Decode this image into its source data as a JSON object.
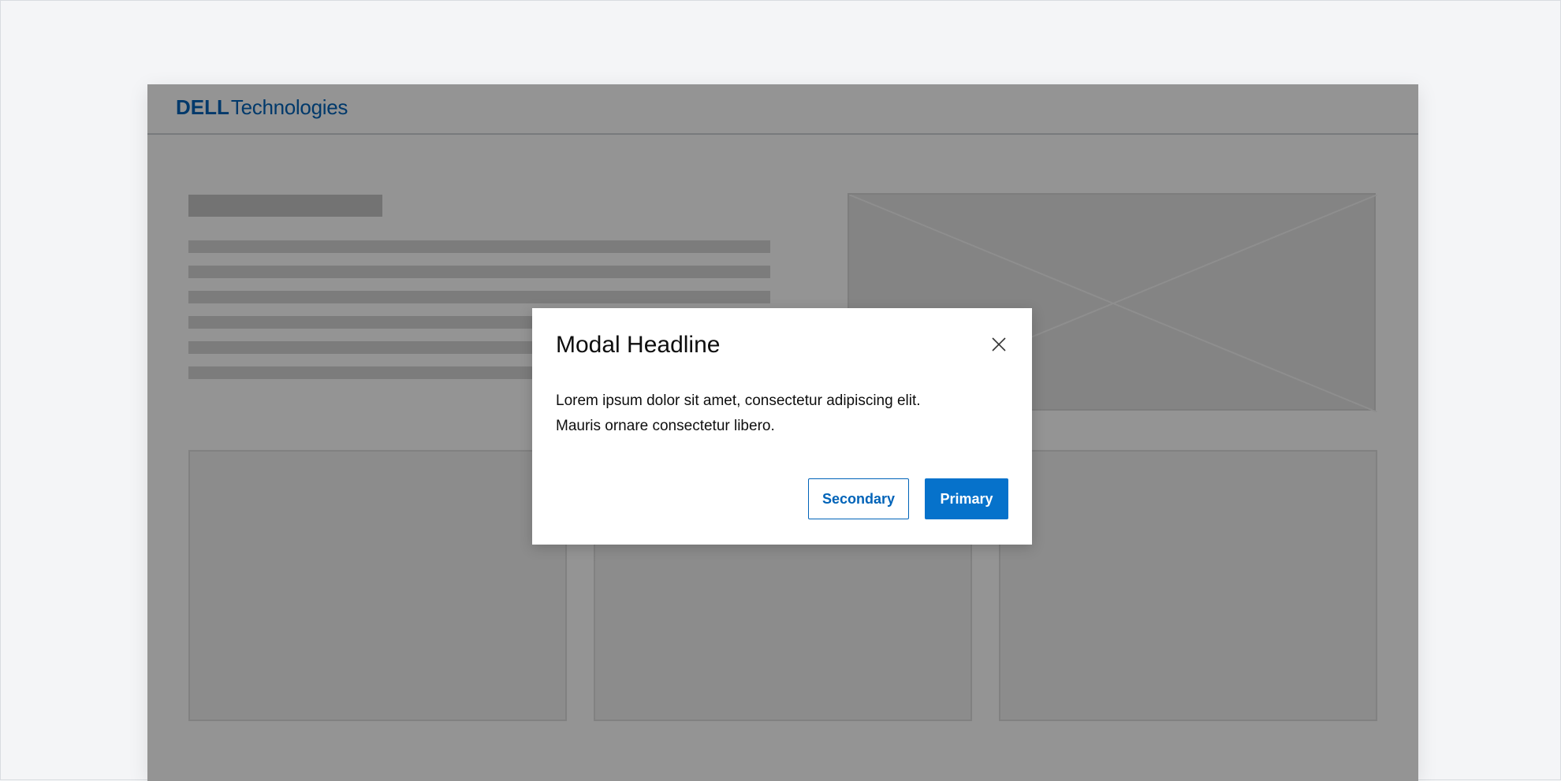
{
  "brand": {
    "logo_dell": "DELL",
    "logo_technologies": "Technologies",
    "color": "#0063b8"
  },
  "modal": {
    "headline": "Modal Headline",
    "body_line_1": "Lorem ipsum dolor sit amet, consectetur adipiscing elit.",
    "body_line_2": "Mauris ornare consectetur libero.",
    "close_icon": "close-icon",
    "secondary_label": "Secondary",
    "primary_label": "Primary",
    "primary_color": "#0672cb"
  },
  "background": {
    "image_placeholder_icon": "image-placeholder-icon"
  }
}
